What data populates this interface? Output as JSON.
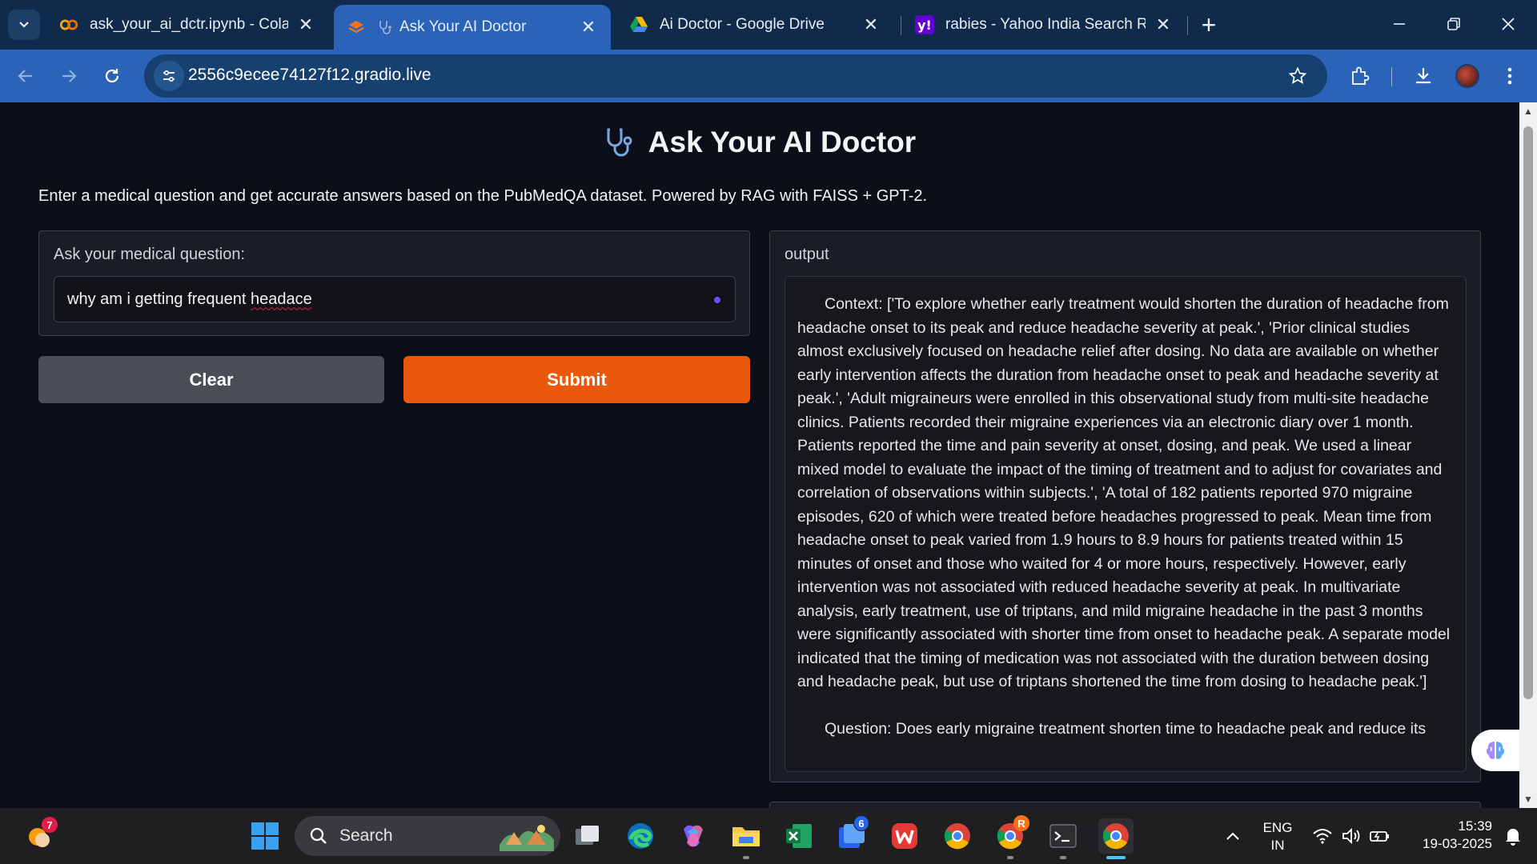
{
  "browser": {
    "tabs": [
      {
        "title": "ask_your_ai_dctr.ipynb - Colab",
        "favicon": "colab-icon",
        "active": false
      },
      {
        "title": "Ask Your AI Doctor",
        "favicon": "gradio-icon",
        "active": true
      },
      {
        "title": "Ai Doctor - Google Drive",
        "favicon": "google-drive-icon",
        "active": false
      },
      {
        "title": "rabies - Yahoo India Search Results",
        "favicon": "yahoo-icon",
        "active": false
      }
    ],
    "url": "2556c9ecee74127f12.gradio.live"
  },
  "app": {
    "title": "Ask Your AI Doctor",
    "description": "Enter a medical question and get accurate answers based on the PubMedQA dataset. Powered by RAG with FAISS + GPT-2.",
    "input_label": "Ask your medical question:",
    "input_value_prefix": "why am i getting frequent ",
    "input_value_misspelled": "headace",
    "clear_label": "Clear",
    "submit_label": "Submit",
    "output_label": "output",
    "output_context": "Context: ['To explore whether early treatment would shorten the duration of headache from headache onset to its peak and reduce headache severity at peak.', 'Prior clinical studies almost exclusively focused on headache relief after dosing. No data are available on whether early intervention affects the duration from headache onset to peak and headache severity at peak.', 'Adult migraineurs were enrolled in this observational study from multi-site headache clinics. Patients recorded their migraine experiences via an electronic diary over 1 month. Patients reported the time and pain severity at onset, dosing, and peak. We used a linear mixed model to evaluate the impact of the timing of treatment and to adjust for covariates and correlation of observations within subjects.', 'A total of 182 patients reported 970 migraine episodes, 620 of which were treated before headaches progressed to peak. Mean time from headache onset to peak varied from 1.9 hours to 8.9 hours for patients treated within 15 minutes of onset and those who waited for 4 or more hours, respectively. However, early intervention was not associated with reduced headache severity at peak. In multivariate analysis, early treatment, use of triptans, and mild migraine headache in the past 3 months were significantly associated with shorter time from onset to headache peak. A separate model indicated that the timing of medication was not associated with the duration between dosing and headache peak, but use of triptans shortened the time from dosing to headache peak.']",
    "output_question": "Question: Does early migraine treatment shorten time to headache peak and reduce its"
  },
  "taskbar": {
    "search_placeholder": "Search",
    "weather_badge": "7",
    "todo_badge": "6",
    "chrome_profile_badge": "R",
    "language": "ENG",
    "region": "IN",
    "time": "15:39",
    "date": "19-03-2025"
  },
  "colors": {
    "accent": "#ea580c",
    "tab_active": "#2b63b8",
    "tabstrip": "#0f2a4a"
  }
}
